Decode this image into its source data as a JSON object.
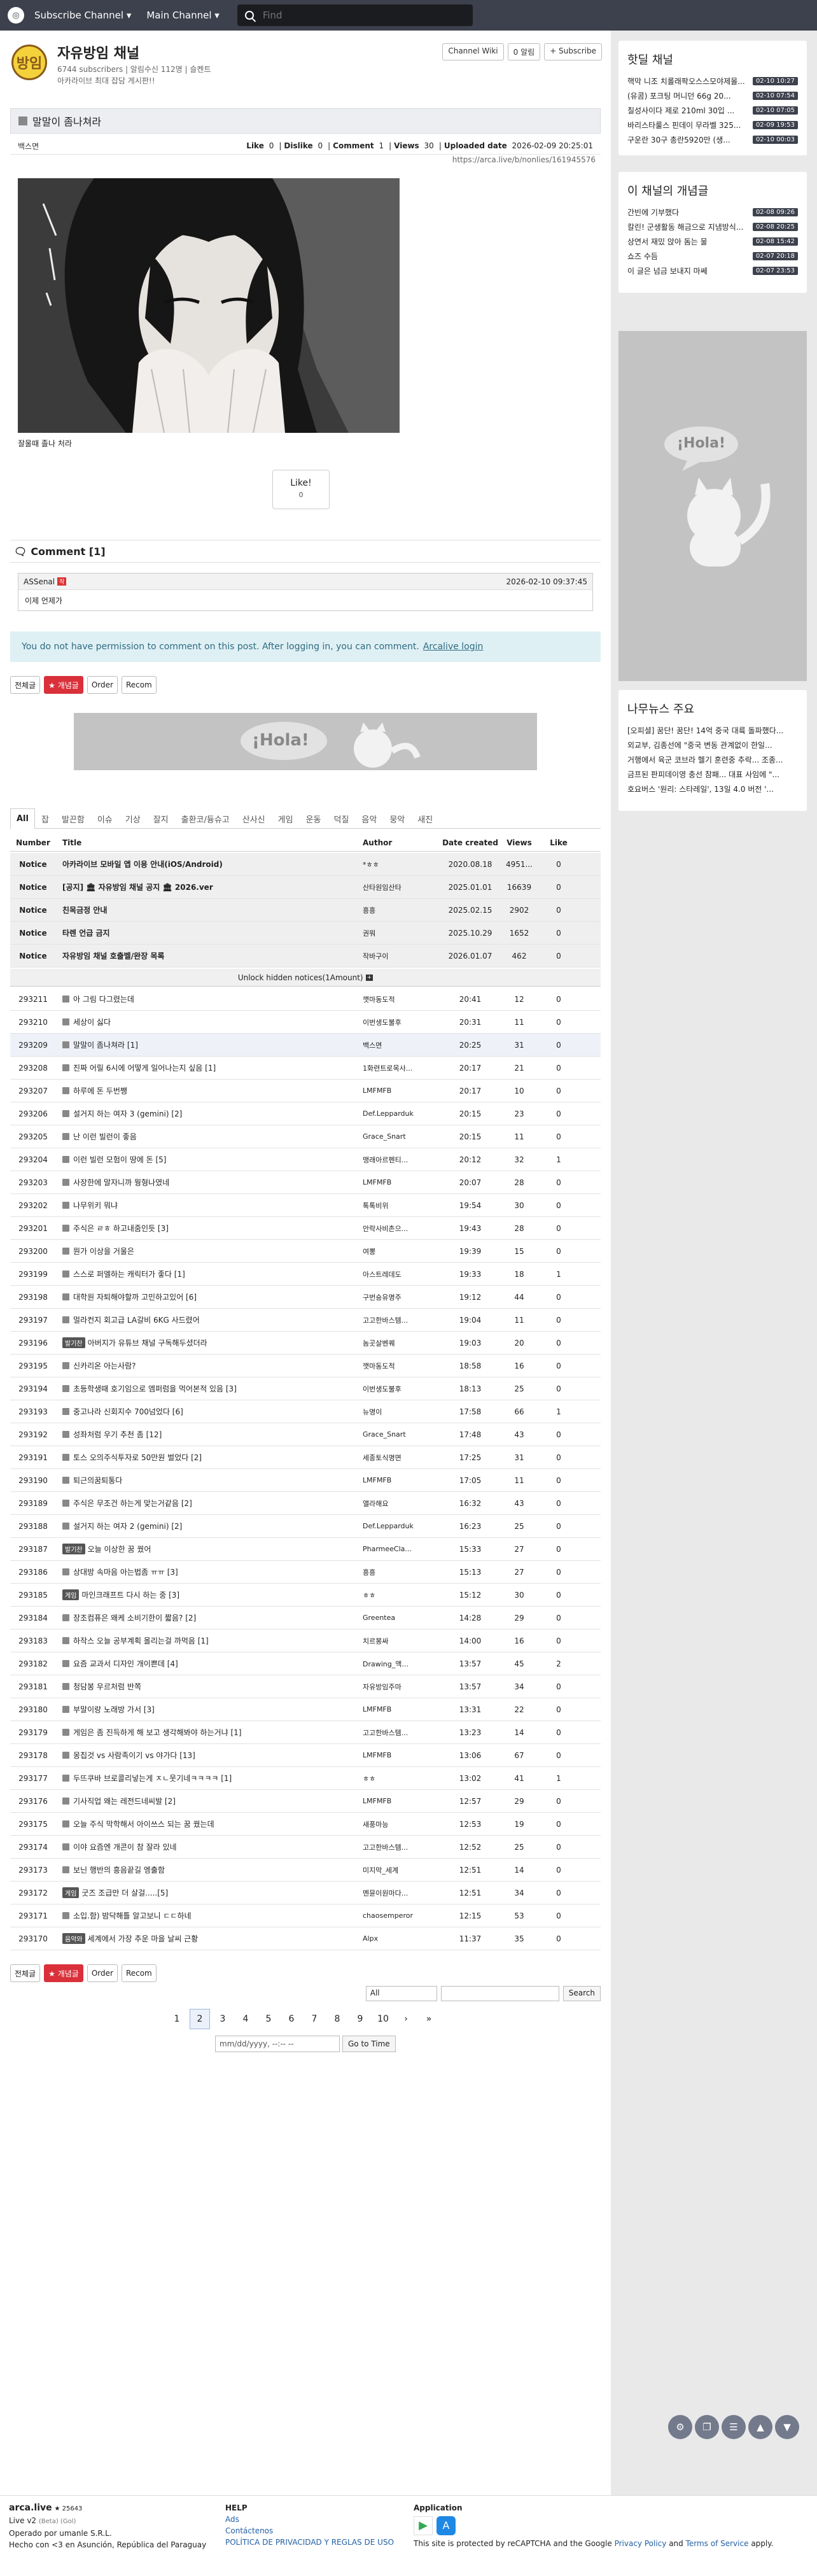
{
  "navbar": {
    "subscribe_channel": "Subscribe Channel ▾",
    "main_channel": "Main Channel ▾",
    "search_placeholder": "Find"
  },
  "channel": {
    "title": "자유방임 채널",
    "logo_text": "방임",
    "stats": "6744 subscribers | 알림수신 112명 | 슬켄트",
    "description": "아카라이브 최대 잡담 게시판!!",
    "wiki_button": "Channel Wiki",
    "alert_button": "0 알림",
    "subscribe_button": "+ Subscribe"
  },
  "article": {
    "title": "말말이 좀나쳐라",
    "author": "백스면",
    "like_label": "Like",
    "like_count": "0",
    "dislike_label": "Dislike",
    "dislike_count": "0",
    "comment_label": "Comment",
    "comment_count": "1",
    "views_label": "Views",
    "views_count": "30",
    "uploaded_label": "Uploaded date",
    "uploaded_date": "2026-02-09 20:25:01",
    "url": "https://arca.live/b/nonlies/161945576",
    "caption": "잘울때 졸나 처라",
    "like_button": "Like!",
    "like_button_count": "0"
  },
  "comments": {
    "header": "Comment [1]",
    "items": [
      {
        "author": "ASSenal",
        "badge": "작",
        "time": "2026-02-10 09:37:45",
        "text": "이제 언제가"
      }
    ],
    "login_note": "You do not have permission to comment on this post. After logging in, you can comment.",
    "login_link": "Arcalive login"
  },
  "filters": {
    "all": "전체글",
    "popular": "★ 개념글",
    "order": "Order",
    "recom": "Recom"
  },
  "categories": [
    "All",
    "잡",
    "발끈함",
    "이슈",
    "기상",
    "잘지",
    "출환코/듕슈고",
    "산사신",
    "게임",
    "운동",
    "덕질",
    "음악",
    "뭉악",
    "새진"
  ],
  "list": {
    "headers": {
      "number": "Number",
      "title": "Title",
      "author": "Author",
      "date": "Date created",
      "views": "Views",
      "like": "Like"
    },
    "notices": [
      {
        "num": "Notice",
        "title": "아카라이브 모바일 앱 이용 안내(iOS/Android)",
        "author": "*ㅎㅎ",
        "date": "2020.08.18",
        "views": "4951...",
        "like": "0"
      },
      {
        "num": "Notice",
        "title": "[공지] 🏛 자유방임 채널 공지 🏛 2026.ver",
        "author": "산타원임산타",
        "date": "2025.01.01",
        "views": "16639",
        "like": "0"
      },
      {
        "num": "Notice",
        "title": "친목금정 안내",
        "author": "흥흥",
        "date": "2025.02.15",
        "views": "2902",
        "like": "0"
      },
      {
        "num": "Notice",
        "title": "타렌 언급 금지",
        "author": "권뭐",
        "date": "2025.10.29",
        "views": "1652",
        "like": "0"
      },
      {
        "num": "Notice",
        "title": "자유방임 채널 호출벨/완장 목록",
        "author": "작바구이",
        "date": "2026.01.07",
        "views": "462",
        "like": "0"
      }
    ],
    "unlock": "Unlock hidden notices(1Amount)",
    "rows": [
      {
        "num": "293211",
        "title": "아 그림 다그렸는데",
        "author": "깻마동도적",
        "time": "20:41",
        "views": "12",
        "like": "0"
      },
      {
        "num": "293210",
        "title": "세상이 싫다",
        "author": "이번생도불후",
        "time": "20:31",
        "views": "11",
        "like": "0"
      },
      {
        "num": "293209",
        "title": "말말이 좀나쳐라 [1]",
        "author": "백스면",
        "time": "20:25",
        "views": "31",
        "like": "0"
      },
      {
        "num": "293208",
        "title": "진짜 어릴 6시에 어떻게 일어나는지 싶음 [1]",
        "author": "1화련트로목사...",
        "time": "20:17",
        "views": "21",
        "like": "0"
      },
      {
        "num": "293207",
        "title": "하루에 돈 두번쨍",
        "author": "LMFMFB",
        "time": "20:17",
        "views": "10",
        "like": "0"
      },
      {
        "num": "293206",
        "title": "설거지 하는 여자 3 (gemini) [2]",
        "author": "Def.Lepparduk",
        "time": "20:15",
        "views": "23",
        "like": "0"
      },
      {
        "num": "293205",
        "title": "난 이런 빌런이 좋음",
        "author": "Grace_Snart",
        "time": "20:15",
        "views": "11",
        "like": "0"
      },
      {
        "num": "293204",
        "title": "이런 빌런 모험이 땅에 돈 [5]",
        "author": "맹래아르펜티...",
        "time": "20:12",
        "views": "32",
        "like": "1"
      },
      {
        "num": "293203",
        "title": "사장한에 말자니까 뭥형나였네",
        "author": "LMFMFB",
        "time": "20:07",
        "views": "28",
        "like": "0"
      },
      {
        "num": "293202",
        "title": "나무위키 뭐냐",
        "author": "톡톡비위",
        "time": "19:54",
        "views": "30",
        "like": "0"
      },
      {
        "num": "293201",
        "title": "주식은 ㄹㅎ 하고내줌인듯 [3]",
        "author": "안락사비촌으...",
        "time": "19:43",
        "views": "28",
        "like": "0"
      },
      {
        "num": "293200",
        "title": "뭔가 이상을 거울은",
        "author": "여뽕",
        "time": "19:39",
        "views": "15",
        "like": "0"
      },
      {
        "num": "293199",
        "title": "스스로 퍼엘하는 캐릭터가 좋다 [1]",
        "author": "아스트레데도",
        "time": "19:33",
        "views": "18",
        "like": "1"
      },
      {
        "num": "293198",
        "title": "대학원 자퇴해야할까 고민하고있어 [6]",
        "author": "구번숑유명주",
        "time": "19:12",
        "views": "44",
        "like": "0"
      },
      {
        "num": "293197",
        "title": "멀라컨지 회고급 LA갈비 6KG 사드렸어",
        "author": "고고한바스템...",
        "time": "19:04",
        "views": "11",
        "like": "0"
      },
      {
        "num": "293196",
        "tag": "발기찬",
        "title": "아버지가 유튜브 채널 구독해두셨더라",
        "author": "놈곳살벤퀘",
        "time": "19:03",
        "views": "20",
        "like": "0"
      },
      {
        "num": "293195",
        "title": "신카리온 아는사람?",
        "author": "깻마동도적",
        "time": "18:58",
        "views": "16",
        "like": "0"
      },
      {
        "num": "293194",
        "title": "초등학생때 호기임으로 엠퍼럼을 먹어본적 있음 [3]",
        "author": "이번생도불후",
        "time": "18:13",
        "views": "25",
        "like": "0"
      },
      {
        "num": "293193",
        "title": "중고나라 신회지수 700넘었다 [6]",
        "author": "뉴명이",
        "time": "17:58",
        "views": "66",
        "like": "1"
      },
      {
        "num": "293192",
        "title": "성좌처럼 우기 추천 좀 [12]",
        "author": "Grace_Snart",
        "time": "17:48",
        "views": "43",
        "like": "0"
      },
      {
        "num": "293191",
        "title": "토스 오의주식투자로 50만원 벌었다 [2]",
        "author": "세종토식명면",
        "time": "17:25",
        "views": "31",
        "like": "0"
      },
      {
        "num": "293190",
        "title": "퇴근의꿈퇴통다",
        "author": "LMFMFB",
        "time": "17:05",
        "views": "11",
        "like": "0"
      },
      {
        "num": "293189",
        "title": "주식은 무조건 하는게 맞는거같음 [2]",
        "author": "앨라해요",
        "time": "16:32",
        "views": "43",
        "like": "0"
      },
      {
        "num": "293188",
        "title": "설거지 하는 여자 2 (gemini) [2]",
        "author": "Def.Lepparduk",
        "time": "16:23",
        "views": "25",
        "like": "0"
      },
      {
        "num": "293187",
        "tag": "발기찬",
        "title": "오늘 이상한 꿈 꿨어",
        "author": "PharmeeCla...",
        "time": "15:33",
        "views": "27",
        "like": "0"
      },
      {
        "num": "293186",
        "title": "상대방 속마음 아는법좀 ㅠㅠ [3]",
        "author": "흥흥",
        "time": "15:13",
        "views": "27",
        "like": "0"
      },
      {
        "num": "293185",
        "tag": "게임",
        "title": "마인크래프트 다시 하는 중 [3]",
        "author": "ㅎㅎ",
        "time": "15:12",
        "views": "30",
        "like": "0"
      },
      {
        "num": "293184",
        "title": "장조컴퓨은 왜케 소비기한이 짧음? [2]",
        "author": "Greentea",
        "time": "14:28",
        "views": "29",
        "like": "0"
      },
      {
        "num": "293183",
        "title": "하작스 오늘 공부계획 올리는걸 까먹음 [1]",
        "author": "치르봉싸",
        "time": "14:00",
        "views": "16",
        "like": "0"
      },
      {
        "num": "293182",
        "title": "요즘 교과서 디자인 개이쁜데 [4]",
        "author": "Drawing_액...",
        "time": "13:57",
        "views": "45",
        "like": "2"
      },
      {
        "num": "293181",
        "title": "청담봉 우르처럼 반쪽",
        "author": "자유방임주마",
        "time": "13:57",
        "views": "34",
        "like": "0"
      },
      {
        "num": "293180",
        "title": "부말이랑 노래방 가서 [3]",
        "author": "LMFMFB",
        "time": "13:31",
        "views": "22",
        "like": "0"
      },
      {
        "num": "293179",
        "title": "게임은 좀 진득하게 해 보고 생각해봐야 하는거냐 [1]",
        "author": "고고한바스템...",
        "time": "13:23",
        "views": "14",
        "like": "0"
      },
      {
        "num": "293178",
        "title": "몽칩것 vs 사람족이기 vs 야가다 [13]",
        "author": "LMFMFB",
        "time": "13:06",
        "views": "67",
        "like": "0"
      },
      {
        "num": "293177",
        "title": "두뜨쿠바 브로콜리넣는게 ㅈㄴ웃기네ㅋㅋㅋㅋ [1]",
        "author": "ㅎㅎ",
        "time": "13:02",
        "views": "41",
        "like": "1"
      },
      {
        "num": "293176",
        "title": "기사직업 왜는 레전드네씨발 [2]",
        "author": "LMFMFB",
        "time": "12:57",
        "views": "29",
        "like": "0"
      },
      {
        "num": "293175",
        "title": "오늘 주식 막학해서 아이쓰스 되는 꿈 꿨는데",
        "author": "새풍마능",
        "time": "12:53",
        "views": "19",
        "like": "0"
      },
      {
        "num": "293174",
        "title": "이야 요즘엔 개콘이 참 잘라 있네",
        "author": "고고한바스템...",
        "time": "12:52",
        "views": "25",
        "like": "0"
      },
      {
        "num": "293173",
        "title": "보닌 행반의 흥음끝길 엥출함",
        "author": "미지막_세계",
        "time": "12:51",
        "views": "14",
        "like": "0"
      },
      {
        "num": "293172",
        "tag": "게임",
        "title": "굿즈 조급만 더 살걸.....[5]",
        "author": "멘뮨이원마다...",
        "time": "12:51",
        "views": "34",
        "like": "0"
      },
      {
        "num": "293171",
        "title": "소입.함) 밤닥해틀 알고보니 ㄷㄷ하네",
        "author": "chaosemperor",
        "time": "12:15",
        "views": "53",
        "like": "0"
      },
      {
        "num": "293170",
        "tag": "음악와",
        "title": "세계에서 가장 추운 마을 날씨 근황",
        "author": "Alpx",
        "time": "11:37",
        "views": "35",
        "like": "0"
      }
    ]
  },
  "bottom_search": {
    "scope": "All",
    "button": "Search"
  },
  "pager": {
    "pages": [
      "1",
      "2",
      "3",
      "4",
      "5",
      "6",
      "7",
      "8",
      "9",
      "10"
    ],
    "current": "2",
    "next": "›",
    "last": "»",
    "date_placeholder": "mm/dd/yyyy, --:-- --",
    "goto": "Go to Time"
  },
  "sidebar": {
    "hot_title": "핫딜 채널",
    "hot_items": [
      {
        "text": "핵막 니조 치롤래팍오스스모야제몰...",
        "time": "02-10 10:27"
      },
      {
        "text": "(유콤) 포크팅 머니던 66g 20...",
        "time": "02-10 07:54"
      },
      {
        "text": "칠성사이다 제로 210ml 30입 ...",
        "time": "02-10 07:05"
      },
      {
        "text": "바리스타룰스 핀데이 무라벨 325...",
        "time": "02-09 19:53"
      },
      {
        "text": "구운란 30구 총란5920만 (생...",
        "time": "02-10 00:03"
      }
    ],
    "concept_title": "이 채널의 개념글",
    "concept_items": [
      {
        "text": "간빈에 기부했다",
        "time": "02-08 09:26"
      },
      {
        "text": "칼린! 군생활동 해금으로 지냄방식...",
        "time": "02-08 20:25"
      },
      {
        "text": "상연서 재밌 앉아 돔는 물",
        "time": "02-08 15:42"
      },
      {
        "text": "쇼즈 수듬",
        "time": "02-07 20:18"
      },
      {
        "text": "이 글은 넘금 보내지 마쎄",
        "time": "02-07 23:53"
      }
    ],
    "news_title": "나무뉴스 주요",
    "news_items": [
      "[오피셜] 꿈단! 꿈단! 14억 중국 대륙 돌파했다...",
      "외교부, 김종선에 \"중국 변동 관계없이 한일...",
      "거행에서 육군 코브라 헬기 훈련중 추락... 조종...",
      "금프된 판피데이영 충선 참패... 대표 사임에 \"...",
      "호요버스 '원리: 스타레일', 13일 4.0 버전 '..."
    ]
  },
  "ad": {
    "text": "¡Hola!"
  },
  "footer": {
    "brand": "arca.live",
    "count": "★ 25643",
    "version": "Live v2",
    "version_sub": "(Beta) (Gol)",
    "operator": "Operado por umanle S.R.L.",
    "made": "Hecho con <3 en Asunción, República del Paraguay",
    "help_title": "HELP",
    "help_ads": "Ads",
    "help_contact": "Contáctenos",
    "help_privacy": "POLÍTICA DE PRIVACIDAD Y REGLAS DE USO",
    "app_title": "Application",
    "recaptcha": "This site is protected by reCAPTCHA and the Google",
    "privacy": "Privacy Policy",
    "and": "and",
    "terms": "Terms of Service",
    "apply": "apply."
  }
}
